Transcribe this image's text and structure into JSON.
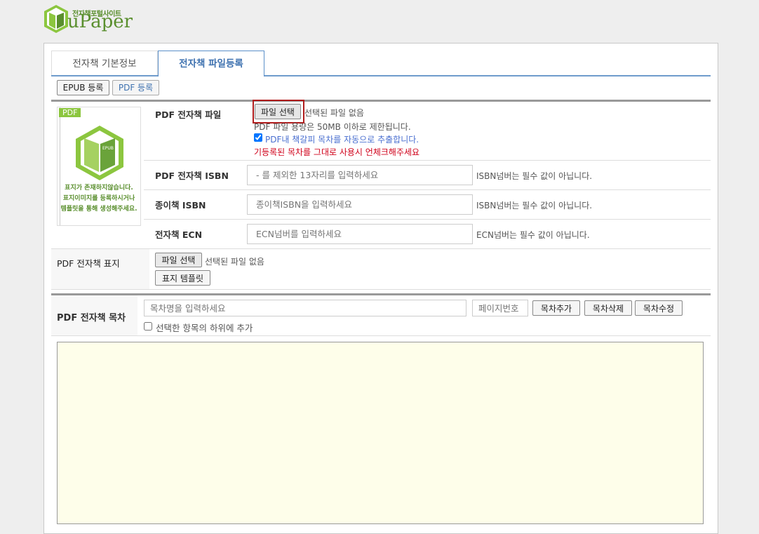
{
  "logo": {
    "subtitle": "전자책포털사이트",
    "title": "uPaper",
    "badge": "EPUB"
  },
  "tabs": [
    {
      "label": "전자책 기본정보",
      "active": false
    },
    {
      "label": "전자책 파일등록",
      "active": true
    }
  ],
  "subtabs": [
    {
      "label": "EPUB 등록"
    },
    {
      "label": "PDF 등록"
    }
  ],
  "thumbnail": {
    "badge": "PDF",
    "book_label": "EPUB",
    "message": [
      "표지가 존재하지않습니다.",
      "표지이미지를 등록하시거나",
      "템플릿을 통해 생성해주세요."
    ]
  },
  "form": {
    "pdf_file": {
      "label": "PDF 전자책 파일",
      "button": "파일 선택",
      "status": "선택된 파일 없음",
      "size_note": "PDF 파일 용량은 50MB 이하로 제한됩니다.",
      "checkbox_label": "PDF내 책갈피 목차를 자동으로 추출합니다.",
      "checkbox_checked": true,
      "warning": "기등록된 목차를 그대로 사용시 언체크해주세요"
    },
    "pdf_isbn": {
      "label": "PDF 전자책 ISBN",
      "placeholder": "- 를 제외한 13자리를 입력하세요",
      "note": "ISBN넘버는 필수 값이 아닙니다."
    },
    "paper_isbn": {
      "label": "종이책 ISBN",
      "placeholder": "종이책ISBN을 입력하세요",
      "note": "ISBN넘버는 필수 값이 아닙니다."
    },
    "ecn": {
      "label": "전자책 ECN",
      "placeholder": "ECN넘버를 입력하세요",
      "note": "ECN넘버는 필수 값이 아닙니다."
    },
    "cover": {
      "label": "PDF 전자책 표지",
      "button": "파일 선택",
      "status": "선택된 파일 없음",
      "template_button": "표지 템플릿"
    },
    "toc": {
      "label": "PDF 전자책 목차",
      "name_placeholder": "목차명을 입력하세요",
      "page_placeholder": "페이지번호",
      "add": "목차추가",
      "delete": "목차삭제",
      "edit": "목차수정",
      "child_checkbox": "선택한 항목의 하위에 추가"
    }
  },
  "colors": {
    "accent": "#3f72b0",
    "warning": "#d0021b",
    "brand": "#5a8f2e",
    "toc_bg": "#fefeea"
  }
}
